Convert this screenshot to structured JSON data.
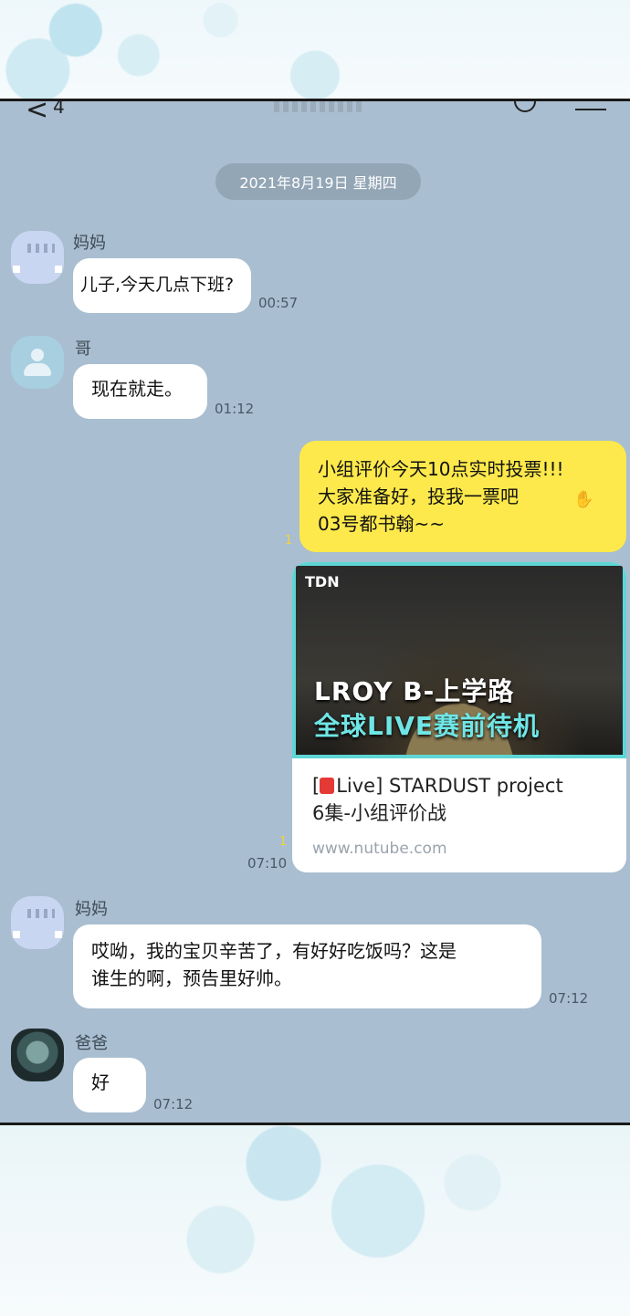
{
  "header": {
    "back_count": "4"
  },
  "date_divider": "2021年8月19日 星期四",
  "messages": [
    {
      "sender": "妈妈",
      "text": "儿子,今天几点下班?",
      "time": "00:57"
    },
    {
      "sender": "哥",
      "text": "现在就走。",
      "time": "01:12"
    },
    {
      "text_lines": [
        "小组评价今天10点实时投票!!!",
        "大家准备好，投我一票吧",
        "03号都书翰~~"
      ],
      "unread": "1"
    },
    {
      "link": {
        "thumb_logo": "TDN",
        "thumb_line1": "LROY B-上学路",
        "thumb_line2": "全球LIVE赛前待机",
        "title_prefix": "[",
        "title_line1": "Live] STARDUST project",
        "title_line2": "6集-小组评价战",
        "url": "www.nutube.com"
      },
      "unread": "1",
      "time": "07:10"
    },
    {
      "sender": "妈妈",
      "text_lines": [
        "哎呦，我的宝贝辛苦了，有好好吃饭吗？这是",
        "谁生的啊，预告里好帅。"
      ],
      "time": "07:12"
    },
    {
      "sender": "爸爸",
      "text": "好",
      "time": "07:12"
    }
  ]
}
